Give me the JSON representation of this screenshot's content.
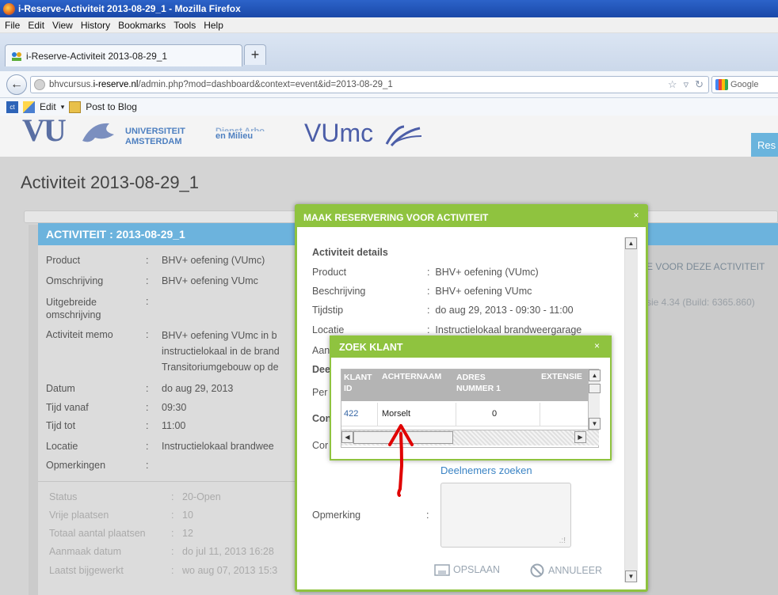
{
  "browser": {
    "window_title": "i-Reserve-Activiteit 2013-08-29_1 - Mozilla Firefox",
    "menu": [
      "File",
      "Edit",
      "View",
      "History",
      "Bookmarks",
      "Tools",
      "Help"
    ],
    "tab_title": "i-Reserve-Activiteit 2013-08-29_1",
    "new_tab": "+",
    "url_prefix": "bhvcursus.",
    "url_host": "i-reserve.nl",
    "url_path": "/admin.php?mod=dashboard&context=event&id=2013-08-29_1",
    "search_placeholder": "Google",
    "bookmarks": [
      "Edit",
      "Post to Blog"
    ]
  },
  "header": {
    "vu_logo": "VU",
    "vu_line1": "UNIVERSITEIT",
    "vu_line2": "AMSTERDAM",
    "dienst_line1": "Dienst Arbo",
    "dienst_line2": "en Milieu",
    "vumc": "VUmc",
    "res_tab": "Res"
  },
  "page": {
    "title": "Activiteit 2013-08-29_1",
    "panel_title": "ACTIVITEIT : 2013-08-29_1",
    "right_link": "E VOOR DEZE ACTIVITEIT",
    "right_version": "sie 4.34 (Build: 6365.860)",
    "details": [
      {
        "label": "Product",
        "value": "BHV+ oefening (VUmc)"
      },
      {
        "label": "Omschrijving",
        "value": "BHV+ oefening VUmc"
      },
      {
        "label": "Uitgebreide omschrijving",
        "value": ""
      },
      {
        "label": "Activiteit memo",
        "value": "BHV+ oefening VUmc in b\ninstructielokaal in de brand\nTransitoriumgebouw op de"
      },
      {
        "label": "Datum",
        "value": "do aug 29, 2013"
      },
      {
        "label": "Tijd vanaf",
        "value": "09:30"
      },
      {
        "label": "Tijd tot",
        "value": "11:00"
      },
      {
        "label": "Locatie",
        "value": "Instructielokaal brandwee"
      },
      {
        "label": "Opmerkingen",
        "value": ""
      }
    ],
    "status": [
      {
        "label": "Status",
        "value": "20-Open"
      },
      {
        "label": "Vrije plaatsen",
        "value": "10"
      },
      {
        "label": "Totaal aantal plaatsen",
        "value": "12"
      },
      {
        "label": "Aanmaak datum",
        "value": "do jul 11, 2013 16:28"
      },
      {
        "label": "Laatst bijgewerkt",
        "value": "wo aug 07, 2013 15:3"
      }
    ]
  },
  "modal": {
    "title": "MAAK RESERVERING VOOR ACTIVITEIT",
    "close": "×",
    "section_title": "Activiteit details",
    "rows": [
      {
        "label": "Product",
        "value": "BHV+ oefening (VUmc)"
      },
      {
        "label": "Beschrijving",
        "value": "BHV+ oefening VUmc"
      },
      {
        "label": "Tijdstip",
        "value": "do aug 29, 2013 - 09:30 - 11:00"
      },
      {
        "label": "Locatie",
        "value": "Instructielokaal brandweergarage"
      }
    ],
    "partial_labels": [
      "Aan",
      "Dee",
      "Per",
      "Con",
      "Cor"
    ],
    "deelnemers_link": "Deelnemers zoeken",
    "opmerking_label": "Opmerking",
    "save_label": "OPSLAAN",
    "cancel_label": "ANNULEER"
  },
  "zoek_klant": {
    "title": "ZOEK KLANT",
    "close": "×",
    "columns": [
      "KLANT ID",
      "ACHTERNAAM",
      "ADRES NUMMER 1",
      "EXTENSIE"
    ],
    "rows": [
      {
        "klant_id": "422",
        "achternaam": "Morselt",
        "adres_nummer": "0",
        "extensie": ""
      }
    ]
  },
  "colors": {
    "green_accent": "#8fc33f",
    "blue_header": "#6cb3dd",
    "annotation_arrow": "#e00000"
  }
}
